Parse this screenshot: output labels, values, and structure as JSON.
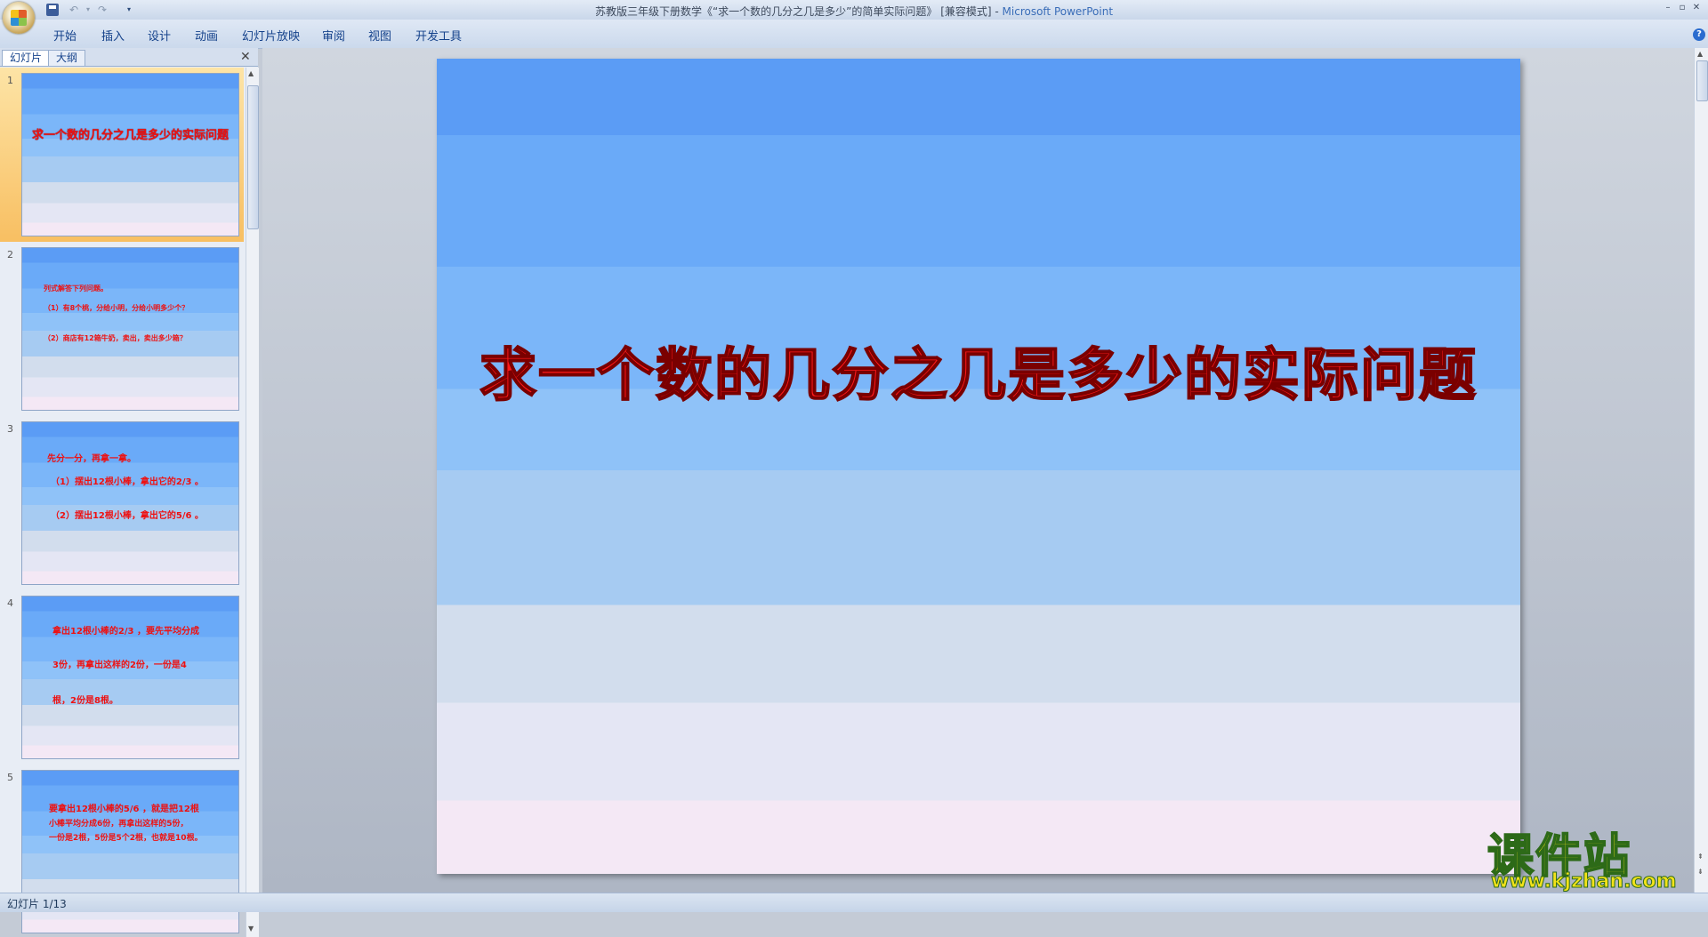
{
  "window": {
    "title": "苏教版三年级下册数学《“求一个数的几分之几是多少”的简单实际问题》 [兼容模式] - ",
    "app_name": "Microsoft PowerPoint"
  },
  "ribbon": {
    "tabs": [
      "开始",
      "插入",
      "设计",
      "动画",
      "幻灯片放映",
      "审阅",
      "视图",
      "开发工具"
    ]
  },
  "left_pane": {
    "tabs": [
      "幻灯片",
      "大纲"
    ],
    "thumbnails": [
      {
        "num": "1",
        "title": "求一个数的几分之几是多少的实际问题"
      },
      {
        "num": "2",
        "lines": [
          "列式解答下列问题。",
          "（1）有8个桃，分给小明，分给小明多少个？",
          "（2）商店有12箱牛奶，卖出，卖出多少箱？"
        ]
      },
      {
        "num": "3",
        "lines": [
          "先分一分，再拿一拿。",
          "（1）摆出12根小棒，拿出它的2/3 。",
          "（2）摆出12根小棒，拿出它的5/6 。"
        ]
      },
      {
        "num": "4",
        "lines": [
          "拿出12根小棒的2/3 ，要先平均分成",
          "3份，再拿出这样的2份，一份是4",
          "根，2份是8根。"
        ]
      },
      {
        "num": "5",
        "lines": [
          "要拿出12根小棒的5/6 ，就是把12根",
          "小棒平均分成6份，再拿出这样的5份，",
          "一份是2根，5份是5个2根，也就是10根。"
        ]
      }
    ]
  },
  "slide": {
    "title": "求一个数的几分之几是多少的实际问题"
  },
  "watermark": {
    "cn": "课件站",
    "url": "www.kjzhan.com"
  },
  "status": {
    "slide_indicator": "幻灯片 1/13"
  }
}
